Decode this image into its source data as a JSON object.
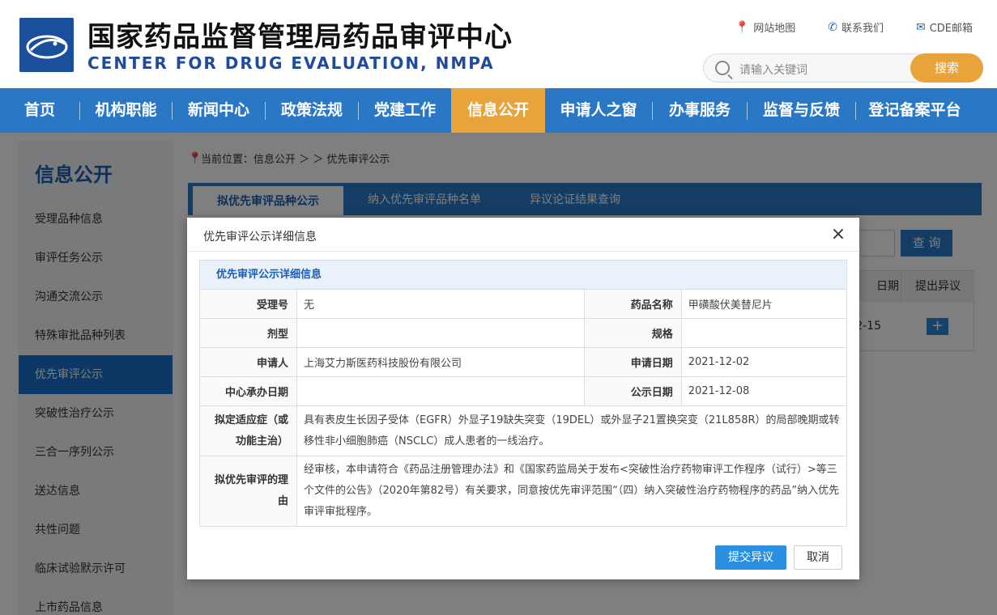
{
  "header": {
    "title_cn": "国家药品监督管理局药品审评中心",
    "title_en": "CENTER FOR DRUG EVALUATION, NMPA",
    "links": [
      {
        "label": "网站地图",
        "icon": "location-pin-icon"
      },
      {
        "label": "联系我们",
        "icon": "phone-icon"
      },
      {
        "label": "CDE邮箱",
        "icon": "mail-icon"
      }
    ],
    "search": {
      "placeholder": "请输入关键词",
      "button": "搜索"
    }
  },
  "nav": {
    "items": [
      "首页",
      "机构职能",
      "新闻中心",
      "政策法规",
      "党建工作",
      "信息公开",
      "申请人之窗",
      "办事服务",
      "监督与反馈",
      "登记备案平台"
    ],
    "active_index": 5
  },
  "sidebar": {
    "title": "信息公开",
    "items": [
      "受理品种信息",
      "审评任务公示",
      "沟通交流公示",
      "特殊审批品种列表",
      "优先审评公示",
      "突破性治疗公示",
      "三合一序列公示",
      "送达信息",
      "共性问题",
      "临床试验默示许可",
      "上市药品信息"
    ],
    "active_index": 4
  },
  "breadcrumb": {
    "text": "当前位置：信息公开 ＞ ＞ 优先审评公示"
  },
  "tabs": [
    "拟优先审评品种公示",
    "纳入优先审评品种名单",
    "异议论证结果查询"
  ],
  "background": {
    "query_button": "查 询",
    "col_date_partial": "日期",
    "col_objection": "提出异议",
    "row_date_partial": "2-15",
    "plus": "+"
  },
  "modal": {
    "title": "优先审评公示详细信息",
    "close": "×",
    "caption": "优先审评公示详细信息",
    "fields": {
      "acceptance_no_label": "受理号",
      "acceptance_no": "无",
      "drug_name_label": "药品名称",
      "drug_name": "甲磺酸伏美替尼片",
      "dosage_form_label": "剂型",
      "dosage_form": "",
      "spec_label": "规格",
      "spec": "",
      "applicant_label": "申请人",
      "applicant": "上海艾力斯医药科技股份有限公司",
      "apply_date_label": "申请日期",
      "apply_date": "2021-12-02",
      "undertake_date_label": "中心承办日期",
      "undertake_date": "",
      "publicity_date_label": "公示日期",
      "publicity_date": "2021-12-08",
      "indication_label": "拟定适应症（或功能主治）",
      "indication": "具有表皮生长因子受体（EGFR）外显子19缺失突变（19DEL）或外显子21置换突变（21L858R）的局部晚期或转移性非小细胞肺癌（NSCLC）成人患者的一线治疗。",
      "reason_label": "拟优先审评的理由",
      "reason": "经审核，本申请符合《药品注册管理办法》和《国家药监局关于发布<突破性治疗药物审评工作程序（试行）>等三个文件的公告》（2020年第82号）有关要求，同意按优先审评范围“（四）纳入突破性治疗药物程序的药品”纳入优先审评审批程序。"
    },
    "submit_button": "提交异议",
    "cancel_button": "取消"
  }
}
